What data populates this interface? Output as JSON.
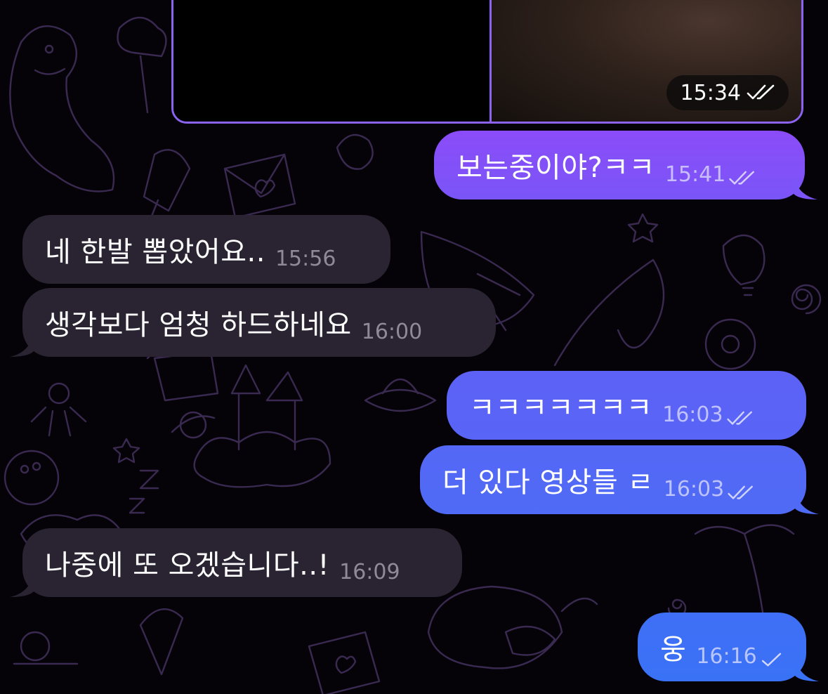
{
  "media": {
    "time": "15:34",
    "status": "read-double-check-icon"
  },
  "messages": [
    {
      "id": "m1",
      "direction": "outgoing",
      "text": "보는중이야?ㅋㅋ",
      "time": "15:41",
      "status": "read"
    },
    {
      "id": "m2",
      "direction": "incoming",
      "text": "네 한발 뽑았어요..",
      "time": "15:56"
    },
    {
      "id": "m3",
      "direction": "incoming",
      "text": "생각보다 엄청 하드하네요",
      "time": "16:00"
    },
    {
      "id": "m4",
      "direction": "outgoing",
      "text": "ㅋㅋㅋㅋㅋㅋㅋ",
      "time": "16:03",
      "status": "read"
    },
    {
      "id": "m5",
      "direction": "outgoing",
      "text": "더 있다 영상들 ㄹ",
      "time": "16:03",
      "status": "read"
    },
    {
      "id": "m6",
      "direction": "incoming",
      "text": "나중에 또 오겠습니다..!",
      "time": "16:09"
    },
    {
      "id": "m7",
      "direction": "outgoing",
      "text": "웅",
      "time": "16:16",
      "status": "sent"
    }
  ],
  "colors": {
    "background": "#050307",
    "incoming_bubble": "#2a2331",
    "outgoing_gradient_top": "#8a4cf7",
    "outgoing_gradient_bottom": "#3c6cf6",
    "media_border": "#8b63f0",
    "doodle_stroke": "#3a2a52"
  }
}
